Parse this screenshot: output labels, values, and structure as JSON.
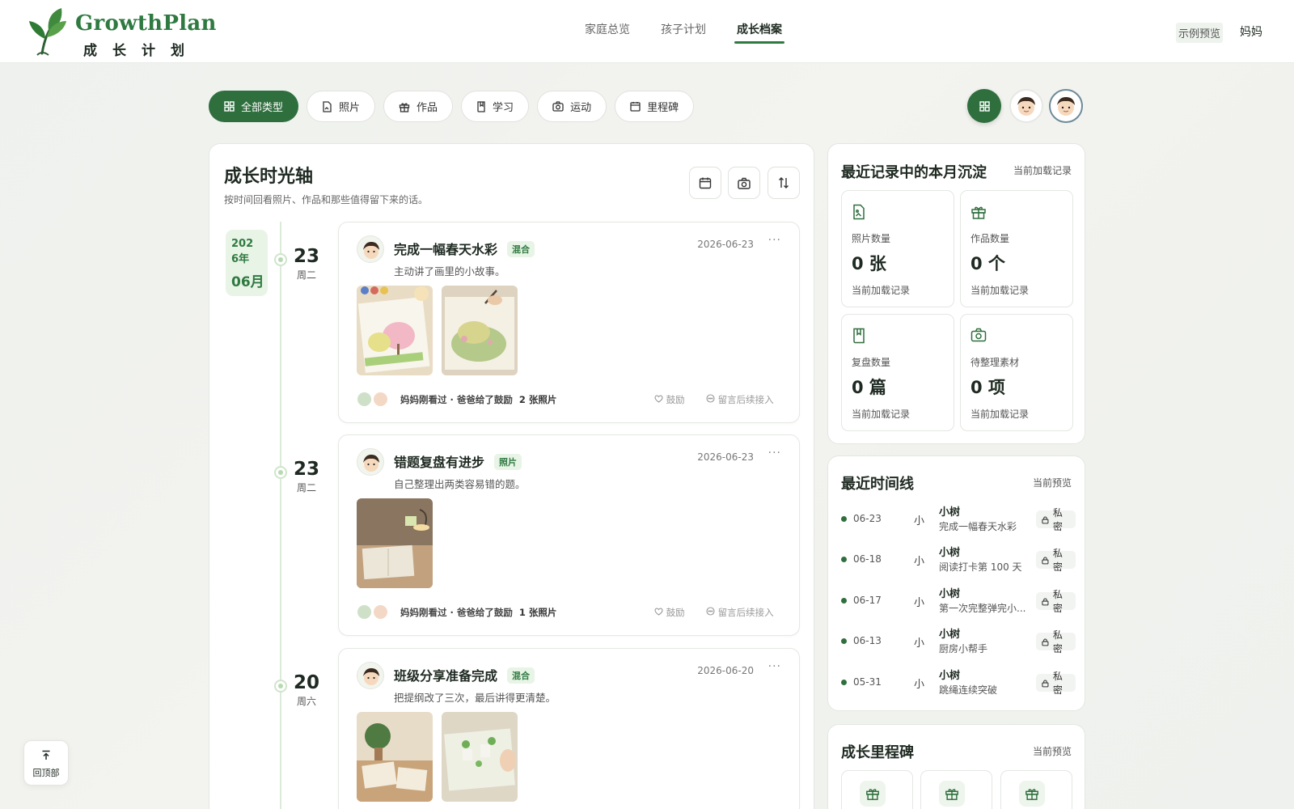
{
  "brand": {
    "title": "GrowthPlan",
    "subtitle": "成长计划"
  },
  "nav": {
    "items": [
      "家庭总览",
      "孩子计划",
      "成长档案"
    ],
    "active_index": 2
  },
  "header_right": {
    "preview": "示例预览",
    "user": "妈妈"
  },
  "filters": {
    "items": [
      {
        "label": "全部类型",
        "icon": "grid-icon",
        "active": true
      },
      {
        "label": "照片",
        "icon": "photo-file-icon"
      },
      {
        "label": "作品",
        "icon": "gift-icon"
      },
      {
        "label": "学习",
        "icon": "book-icon"
      },
      {
        "label": "运动",
        "icon": "camera-icon"
      },
      {
        "label": "里程碑",
        "icon": "calendar-icon"
      }
    ]
  },
  "timeline": {
    "title": "成长时光轴",
    "subtitle": "按时间回看照片、作品和那些值得留下来的话。",
    "month_tag": {
      "year": "2026年",
      "month": "06月"
    },
    "entries": [
      {
        "day": "23",
        "weekday": "周二",
        "title": "完成一幅春天水彩",
        "badge": "混合",
        "date": "2026-06-23",
        "more": "···",
        "desc": "主动讲了画里的小故事。",
        "footer": "妈妈刚看过 · 爸爸给了鼓励",
        "count": "2 张照片",
        "cheer": "鼓励",
        "comment": "留言后续接入"
      },
      {
        "day": "23",
        "weekday": "周二",
        "title": "错题复盘有进步",
        "badge": "照片",
        "date": "2026-06-23",
        "more": "···",
        "desc": "自己整理出两类容易错的题。",
        "footer": "妈妈刚看过 · 爸爸给了鼓励",
        "count": "1 张照片",
        "cheer": "鼓励",
        "comment": "留言后续接入"
      },
      {
        "day": "20",
        "weekday": "周六",
        "title": "班级分享准备完成",
        "badge": "混合",
        "date": "2026-06-20",
        "more": "···",
        "desc": "把提纲改了三次，最后讲得更清楚。"
      }
    ]
  },
  "stats": {
    "title": "最近记录中的本月沉淀",
    "right": "当前加载记录",
    "items": [
      {
        "label": "照片数量",
        "value": "0 张",
        "foot": "当前加载记录",
        "icon": "photo-file-icon"
      },
      {
        "label": "作品数量",
        "value": "0 个",
        "foot": "当前加载记录",
        "icon": "gift-icon"
      },
      {
        "label": "复盘数量",
        "value": "0 篇",
        "foot": "当前加载记录",
        "icon": "book-icon"
      },
      {
        "label": "待整理素材",
        "value": "0 项",
        "foot": "当前加载记录",
        "icon": "camera-icon"
      }
    ]
  },
  "recent": {
    "title": "最近时间线",
    "right": "当前预览",
    "rows": [
      {
        "date": "06-23",
        "small": "小",
        "name": "小树",
        "desc": "完成一幅春天水彩",
        "private": "私密"
      },
      {
        "date": "06-18",
        "small": "小",
        "name": "小树",
        "desc": "阅读打卡第 100 天",
        "private": "私密"
      },
      {
        "date": "06-17",
        "small": "小",
        "name": "小树",
        "desc": "第一次完整弹完小...",
        "private": "私密"
      },
      {
        "date": "06-13",
        "small": "小",
        "name": "小树",
        "desc": "厨房小帮手",
        "private": "私密"
      },
      {
        "date": "05-31",
        "small": "小",
        "name": "小树",
        "desc": "跳绳连续突破",
        "private": "私密"
      }
    ]
  },
  "milestones": {
    "title": "成长里程碑",
    "right": "当前预览"
  },
  "back_top": {
    "label": "回顶部"
  },
  "colors": {
    "brand_green": "#2f7a41",
    "dark_green": "#2f6f3e",
    "tag_bg": "#e8f4e6"
  }
}
